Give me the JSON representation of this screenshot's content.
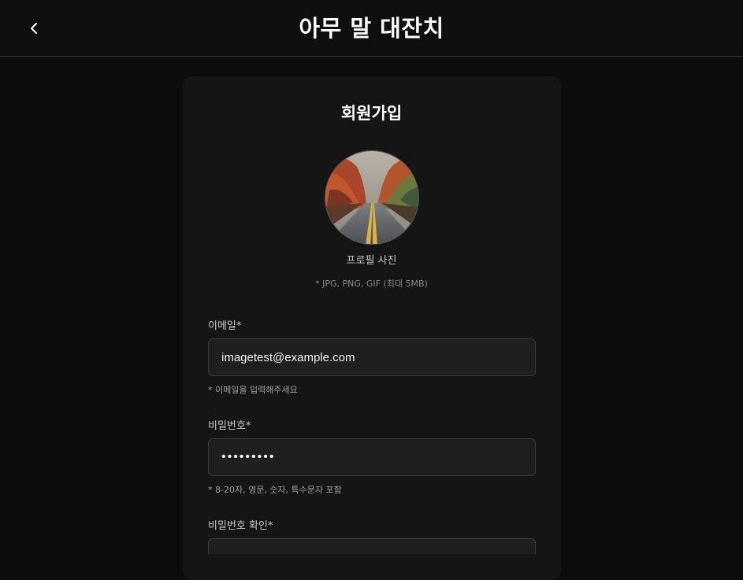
{
  "header": {
    "title": "아무 말 대잔치",
    "back_icon": "chevron-left-icon"
  },
  "form": {
    "title": "회원가입",
    "profile": {
      "label": "프로필 사진",
      "hint": "* JPG, PNG, GIF (최대 5MB)"
    },
    "email": {
      "label": "이메일*",
      "value": "imagetest@example.com",
      "hint": "* 이메일을 입력해주세요"
    },
    "password": {
      "label": "비밀번호*",
      "value": "•••••••••",
      "hint": "* 8-20자, 영문, 숫자, 특수문자 포함"
    },
    "password_confirm": {
      "label": "비밀번호 확인*",
      "value": ""
    }
  },
  "colors": {
    "background": "#0c0c0c",
    "card": "#151515",
    "input": "#1f1f1f"
  }
}
